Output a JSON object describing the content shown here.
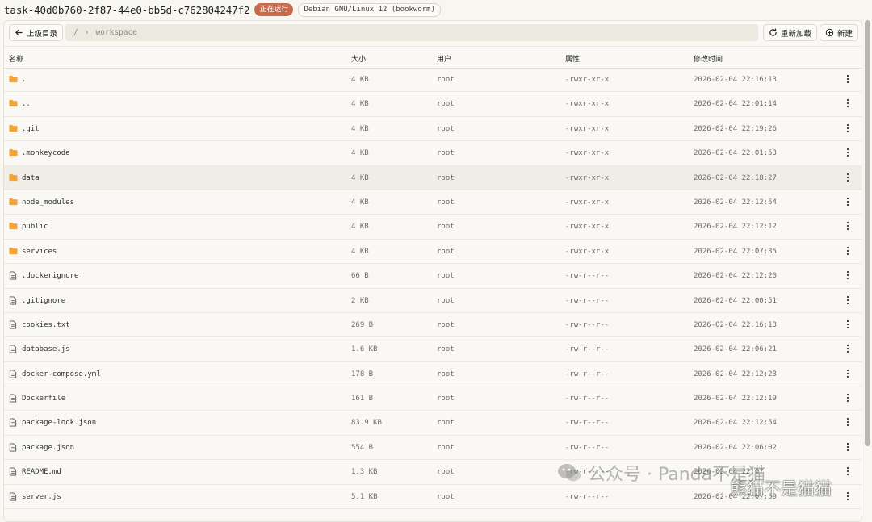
{
  "header": {
    "task_title": "task-40d0b760-2f87-44e0-bb5d-c762804247f2",
    "status_badge": "正在运行",
    "os_badge": "Debian GNU/Linux 12 (bookworm)"
  },
  "toolbar": {
    "up_label": "上级目录",
    "path_root": "/",
    "path_sep": "›",
    "path_segment": "workspace",
    "reload_label": "重新加载",
    "new_label": "新建"
  },
  "columns": {
    "name": "名称",
    "size": "大小",
    "user": "用户",
    "perm": "属性",
    "time": "修改时间"
  },
  "files": [
    {
      "name": ".",
      "type": "folder",
      "size": "4 KB",
      "user": "root",
      "perm": "-rwxr-xr-x",
      "time": "2026-02-04 22:16:13"
    },
    {
      "name": "..",
      "type": "folder",
      "size": "4 KB",
      "user": "root",
      "perm": "-rwxr-xr-x",
      "time": "2026-02-04 22:01:14"
    },
    {
      "name": ".git",
      "type": "folder",
      "size": "4 KB",
      "user": "root",
      "perm": "-rwxr-xr-x",
      "time": "2026-02-04 22:19:26"
    },
    {
      "name": ".monkeycode",
      "type": "folder",
      "size": "4 KB",
      "user": "root",
      "perm": "-rwxr-xr-x",
      "time": "2026-02-04 22:01:53"
    },
    {
      "name": "data",
      "type": "folder",
      "size": "4 KB",
      "user": "root",
      "perm": "-rwxr-xr-x",
      "time": "2026-02-04 22:18:27"
    },
    {
      "name": "node_modules",
      "type": "folder",
      "size": "4 KB",
      "user": "root",
      "perm": "-rwxr-xr-x",
      "time": "2026-02-04 22:12:54"
    },
    {
      "name": "public",
      "type": "folder",
      "size": "4 KB",
      "user": "root",
      "perm": "-rwxr-xr-x",
      "time": "2026-02-04 22:12:12"
    },
    {
      "name": "services",
      "type": "folder",
      "size": "4 KB",
      "user": "root",
      "perm": "-rwxr-xr-x",
      "time": "2026-02-04 22:07:35"
    },
    {
      "name": ".dockerignore",
      "type": "file",
      "size": "66 B",
      "user": "root",
      "perm": "-rw-r--r--",
      "time": "2026-02-04 22:12:20"
    },
    {
      "name": ".gitignore",
      "type": "file",
      "size": "2 KB",
      "user": "root",
      "perm": "-rw-r--r--",
      "time": "2026-02-04 22:00:51"
    },
    {
      "name": "cookies.txt",
      "type": "file",
      "size": "269 B",
      "user": "root",
      "perm": "-rw-r--r--",
      "time": "2026-02-04 22:16:13"
    },
    {
      "name": "database.js",
      "type": "file",
      "size": "1.6 KB",
      "user": "root",
      "perm": "-rw-r--r--",
      "time": "2026-02-04 22:06:21"
    },
    {
      "name": "docker-compose.yml",
      "type": "file",
      "size": "178 B",
      "user": "root",
      "perm": "-rw-r--r--",
      "time": "2026-02-04 22:12:23"
    },
    {
      "name": "Dockerfile",
      "type": "file",
      "size": "161 B",
      "user": "root",
      "perm": "-rw-r--r--",
      "time": "2026-02-04 22:12:19"
    },
    {
      "name": "package-lock.json",
      "type": "file",
      "size": "83.9 KB",
      "user": "root",
      "perm": "-rw-r--r--",
      "time": "2026-02-04 22:12:54"
    },
    {
      "name": "package.json",
      "type": "file",
      "size": "554 B",
      "user": "root",
      "perm": "-rw-r--r--",
      "time": "2026-02-04 22:06:02"
    },
    {
      "name": "README.md",
      "type": "file",
      "size": "1.3 KB",
      "user": "root",
      "perm": "-rw-r--r--",
      "time": "2026-02-04 22:0?"
    },
    {
      "name": "server.js",
      "type": "file",
      "size": "5.1 KB",
      "user": "root",
      "perm": "-rw-r--r--",
      "time": "2026-02-04 22:07:59"
    }
  ],
  "highlighted_row": 4,
  "watermark": {
    "line1": "公众号 · Panda不是猫",
    "line2": "熊猫不是猫猫"
  },
  "colors": {
    "folder": "#f3a33a",
    "accent_badge": "#c86a4e",
    "background": "#f7f6f1"
  }
}
